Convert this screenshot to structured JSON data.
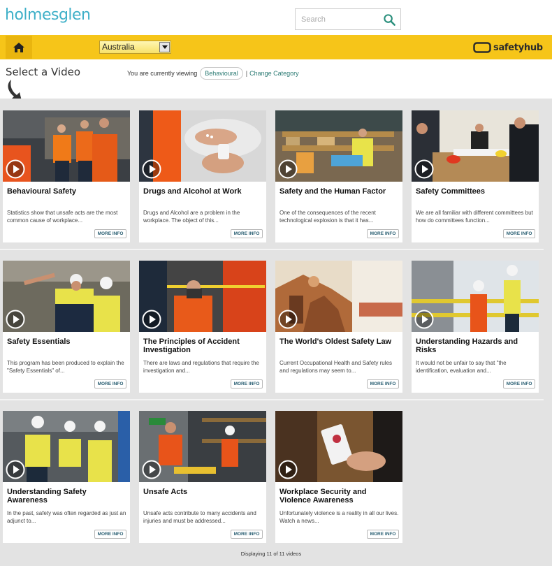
{
  "header": {
    "logo_text": "holmesglen",
    "search_placeholder": "Search",
    "brand_text": "safetyhub"
  },
  "toolbar": {
    "country_selected": "Australia"
  },
  "page": {
    "title": "Select a Video",
    "viewing_prefix": "You are currently viewing",
    "current_category": "Behavioural",
    "separator": "|",
    "change_category": "Change Category"
  },
  "videos": [
    {
      "title": "Behavioural Safety",
      "desc": "Statistics show that unsafe acts are the most common cause of workplace...",
      "more": "MORE INFO"
    },
    {
      "title": "Drugs and Alcohol at Work",
      "desc": "Drugs and Alcohol are a problem in the workplace.  The object of this...",
      "more": "MORE INFO"
    },
    {
      "title": "Safety and the Human Factor",
      "desc": "One of the consequences of the recent technological explosion is that it has...",
      "more": "MORE INFO"
    },
    {
      "title": "Safety Committees",
      "desc": "We are all familiar with different committees but how do committees function...",
      "more": "MORE INFO"
    },
    {
      "title": "Safety Essentials",
      "desc": "This program has been produced to explain the \"Safety Essentials\" of...",
      "more": "MORE INFO"
    },
    {
      "title": "The Principles of Accident Investigation",
      "desc": "There are laws and regulations that require the investigation and...",
      "more": "MORE INFO"
    },
    {
      "title": "The World's Oldest Safety Law",
      "desc": "Current Occupational Health and Safety rules and regulations may seem to...",
      "more": "MORE INFO"
    },
    {
      "title": "Understanding Hazards and Risks",
      "desc": "It would not be unfair to say that \"the identification, evaluation and...",
      "more": "MORE INFO"
    },
    {
      "title": "Understanding Safety Awareness",
      "desc": "In the past, safety was often regarded as just an adjunct to...",
      "more": "MORE INFO"
    },
    {
      "title": "Unsafe Acts",
      "desc": "Unsafe acts contribute to many accidents and injuries and must be addressed...",
      "more": "MORE INFO"
    },
    {
      "title": "Workplace Security and Violence Awareness",
      "desc": "Unfortunately violence is a reality in all our lives.   Watch a news...",
      "more": "MORE INFO"
    }
  ],
  "footer": {
    "status": "Displaying 11 of 11 videos"
  },
  "colors": {
    "brand_yellow": "#f6c519",
    "link_teal": "#2a7a73",
    "logo_blue": "#3fb0c8"
  }
}
